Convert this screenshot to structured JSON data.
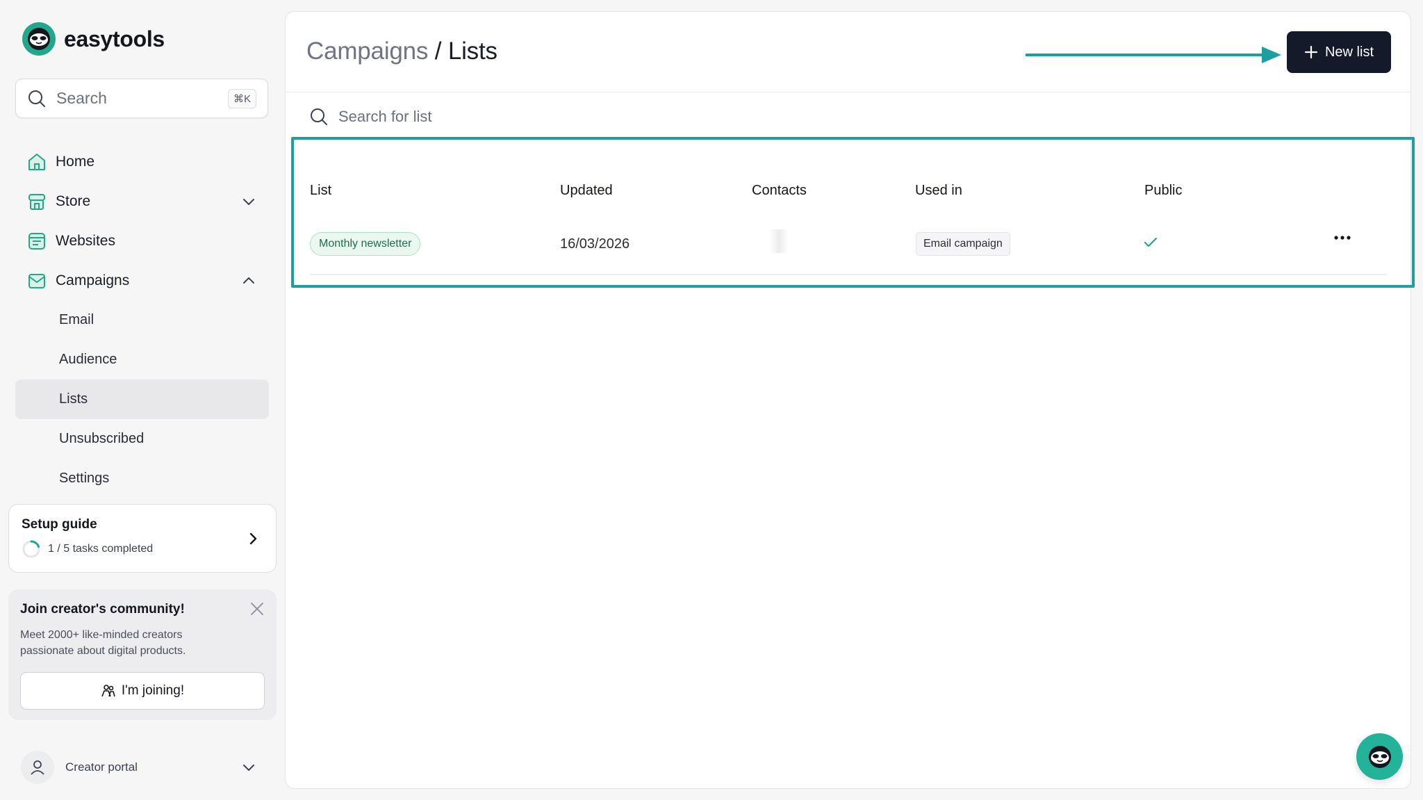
{
  "brand": {
    "name": "easytools"
  },
  "search": {
    "placeholder": "Search",
    "shortcut": "⌘K"
  },
  "sidebar": {
    "items": [
      {
        "label": "Home",
        "icon": "home-icon"
      },
      {
        "label": "Store",
        "icon": "store-icon",
        "expanded": false
      },
      {
        "label": "Websites",
        "icon": "websites-icon"
      },
      {
        "label": "Campaigns",
        "icon": "campaigns-icon",
        "expanded": true
      }
    ],
    "campaign_subitems": [
      {
        "label": "Email",
        "active": false
      },
      {
        "label": "Audience",
        "active": false
      },
      {
        "label": "Lists",
        "active": true
      },
      {
        "label": "Unsubscribed",
        "active": false
      },
      {
        "label": "Settings",
        "active": false
      }
    ]
  },
  "setup_guide": {
    "title": "Setup guide",
    "progress_text": "1 / 5 tasks completed",
    "completed": 1,
    "total": 5
  },
  "community": {
    "title": "Join creator's community!",
    "text": "Meet 2000+ like-minded creators passionate about digital products.",
    "button": "I'm joining!"
  },
  "portal": {
    "label": "Creator portal"
  },
  "header": {
    "breadcrumb_parent": "Campaigns",
    "breadcrumb_sep": " / ",
    "breadcrumb_current": "Lists",
    "new_button": "New list"
  },
  "list_search": {
    "placeholder": "Search for list"
  },
  "table": {
    "headers": [
      "List",
      "Updated",
      "Contacts",
      "Used in",
      "Public"
    ],
    "rows": [
      {
        "list": "Monthly newsletter",
        "updated": "16/03/2026",
        "contacts": "",
        "used_in": "Email campaign",
        "public": true
      }
    ]
  },
  "colors": {
    "brand_green": "#23a78a",
    "annotation_teal": "#1f9ea0",
    "primary_button": "#141a2a",
    "active_nav": "#e8e8ea"
  }
}
